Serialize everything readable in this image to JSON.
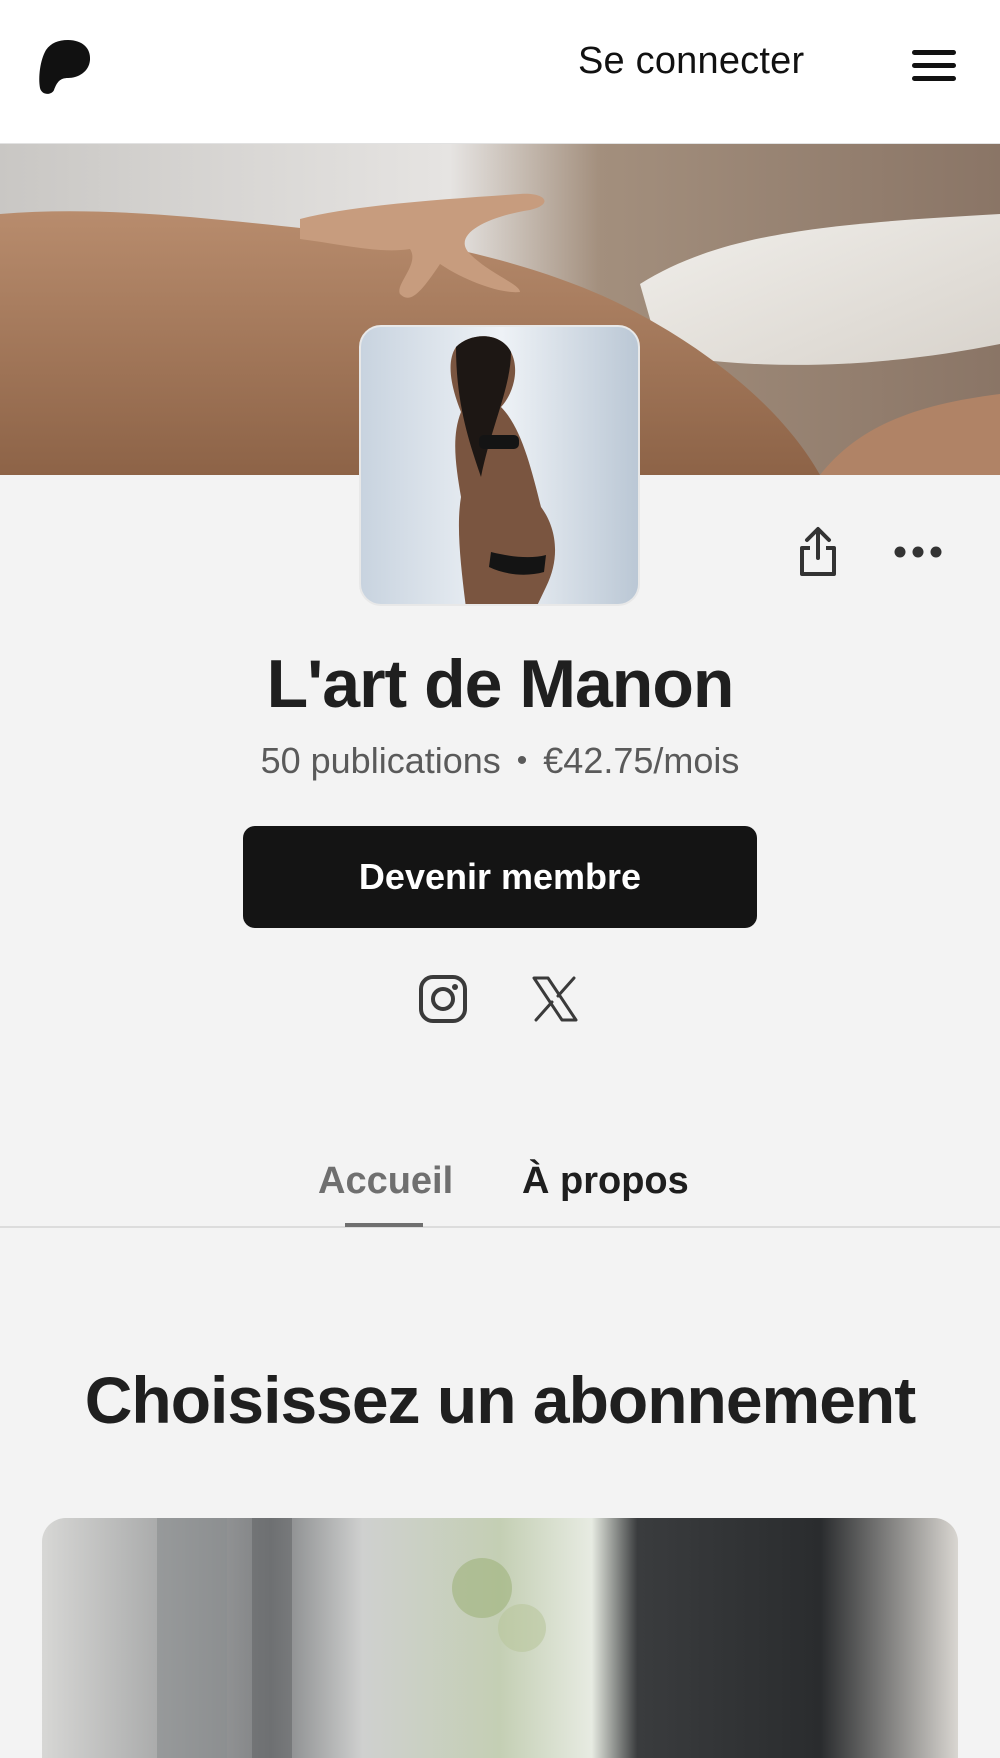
{
  "header": {
    "logo_icon": "patreon-logo-icon",
    "signin_label": "Se connecter",
    "menu_icon": "hamburger-menu-icon"
  },
  "profile": {
    "name": "L'art de Manon",
    "posts": "50 publications",
    "separator": "•",
    "price": "€42.75/mois",
    "join_label": "Devenir membre",
    "share_icon": "share-icon",
    "more_icon": "more-options-icon",
    "social": [
      "instagram-icon",
      "x-icon"
    ]
  },
  "tabs": [
    {
      "label": "Accueil",
      "active": true
    },
    {
      "label": "À propos",
      "active": false
    }
  ],
  "tiers": {
    "title": "Choisissez un abonnement"
  },
  "colors": {
    "background": "#f3f3f3",
    "button": "#141414",
    "text": "#1f1f1f",
    "muted": "#6f6f6f"
  }
}
